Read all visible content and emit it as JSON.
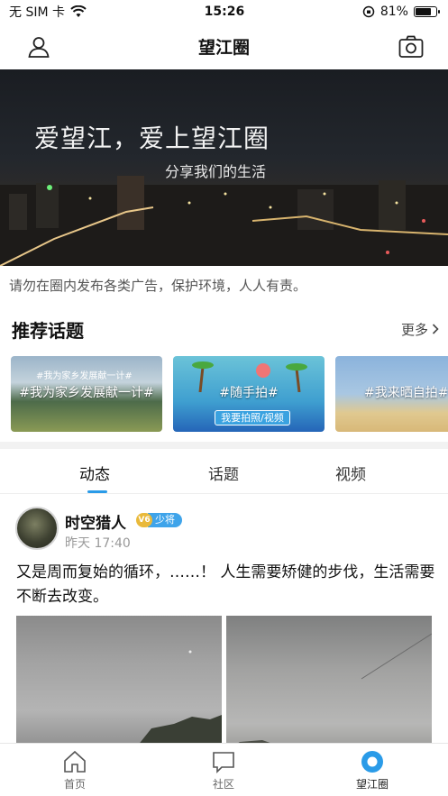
{
  "status_bar": {
    "carrier": "无 SIM 卡",
    "time": "15:26",
    "battery_percent": "81%",
    "battery_level": 0.81
  },
  "nav": {
    "title": "望江圈",
    "left_icon": "user-icon",
    "right_icon": "camera-icon"
  },
  "banner": {
    "title": "爱望江，爱上望江圈",
    "subtitle": "分享我们的生活"
  },
  "notice": "请勿在圈内发布各类广告，保护环境，人人有责。",
  "topics_section": {
    "title": "推荐话题",
    "more_label": "更多",
    "cards": [
      {
        "label": "#我为家乡发展献一计#",
        "tag": "#我为家乡发展献一计#"
      },
      {
        "label": "#随手拍#",
        "badge": "我要拍照/视频"
      },
      {
        "label": "#我来晒自拍#"
      }
    ]
  },
  "feed_tabs": {
    "items": [
      "动态",
      "话题",
      "视频"
    ],
    "active": "动态"
  },
  "post": {
    "author": "时空猎人",
    "level_badge": "V6",
    "rank": "少将",
    "time": "昨天 17:40",
    "text": "又是周而复始的循环，……！ 人生需要矫健的步伐，生活需要不断去改变。"
  },
  "tabbar": {
    "items": [
      {
        "label": "首页",
        "icon": "home-icon"
      },
      {
        "label": "社区",
        "icon": "chat-icon"
      },
      {
        "label": "望江圈",
        "icon": "circle-icon"
      }
    ],
    "active": "望江圈",
    "accent": "#2a9be8"
  }
}
